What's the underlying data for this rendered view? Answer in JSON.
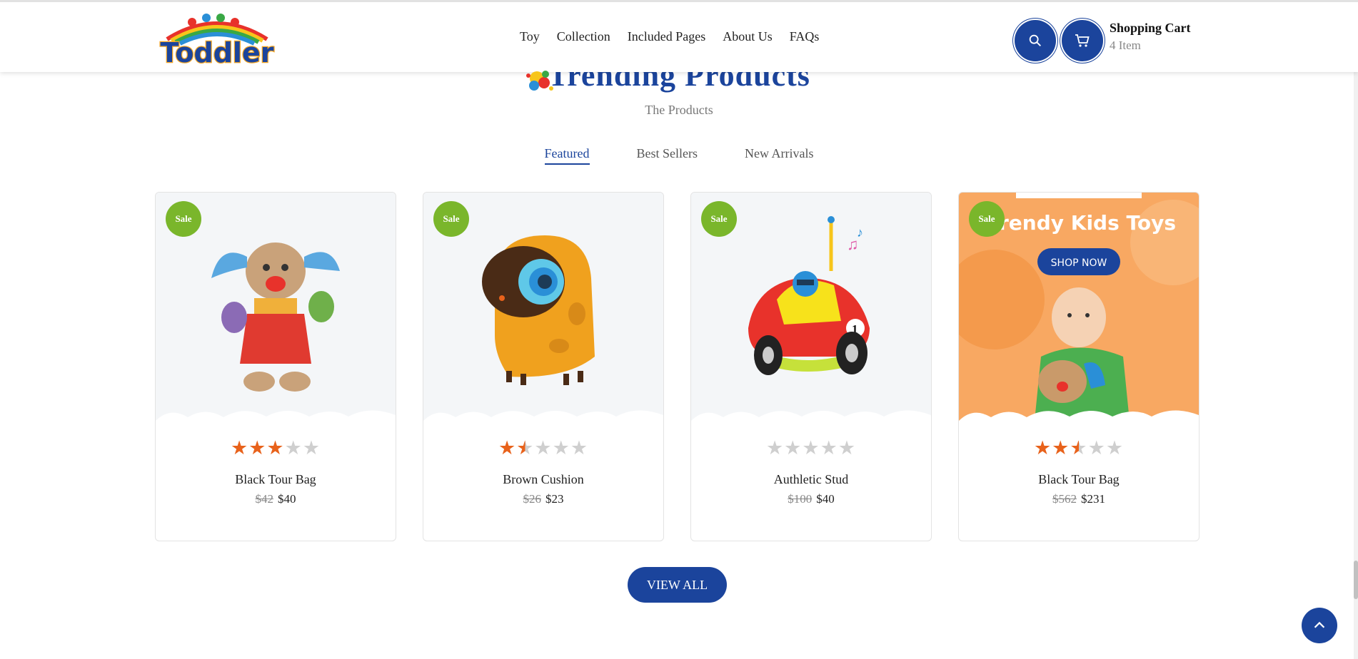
{
  "header": {
    "logo_text": "Toddler",
    "nav": [
      "Toy",
      "Collection",
      "Included Pages",
      "About Us",
      "FAQs"
    ],
    "cart_title": "Shopping Cart",
    "cart_count": "4 Item"
  },
  "section": {
    "title": "Trending Products",
    "subtitle": "The Products",
    "tabs": [
      "Featured",
      "Best Sellers",
      "New Arrivals"
    ],
    "active_tab": "Featured"
  },
  "products": [
    {
      "badge": "Sale",
      "name": "Black Tour Bag",
      "old_price": "$42",
      "price": "$40",
      "rating": 3
    },
    {
      "badge": "Sale",
      "name": "Brown Cushion",
      "old_price": "$26",
      "price": "$23",
      "rating": 1.5
    },
    {
      "badge": "Sale",
      "name": "Authletic Stud",
      "old_price": "$100",
      "price": "$40",
      "rating": 0
    },
    {
      "badge": "Sale",
      "name": "Black Tour Bag",
      "old_price": "$562",
      "price": "$231",
      "rating": 2.5
    }
  ],
  "banner": {
    "headline": "rendy Kids Toys",
    "button": "SHOP NOW"
  },
  "view_all": "VIEW ALL",
  "colors": {
    "primary": "#1b449c",
    "sale": "#7ab62b",
    "star": "#e8621b",
    "banner_bg": "#f8a862"
  }
}
